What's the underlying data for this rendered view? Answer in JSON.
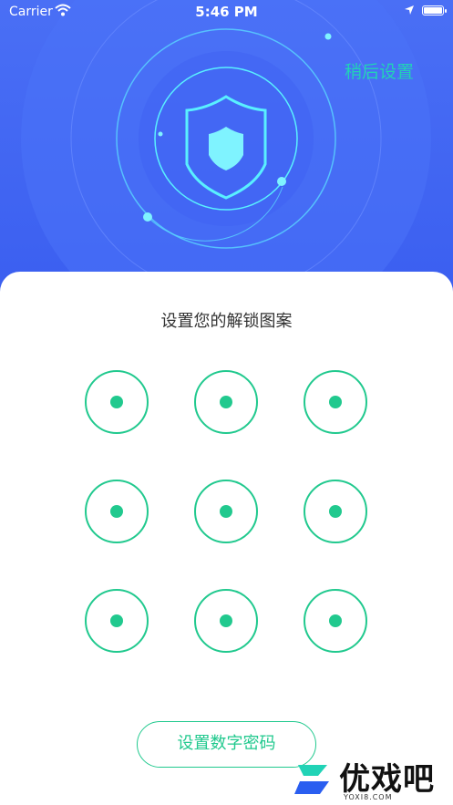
{
  "status_bar": {
    "carrier": "Carrier",
    "time": "5:46 PM"
  },
  "header": {
    "skip_label": "稍后设置"
  },
  "pattern": {
    "title": "设置您的解锁图案",
    "nodes": 9
  },
  "footer": {
    "number_password_label": "设置数字密码"
  },
  "watermark": {
    "text": "优戏吧",
    "domain": "YOXI8.COM"
  },
  "colors": {
    "hero_blue": "#3a5ef0",
    "accent_green": "#21c98e",
    "skip_teal": "#21d3b6",
    "shield_cyan": "#7ff3ff"
  }
}
